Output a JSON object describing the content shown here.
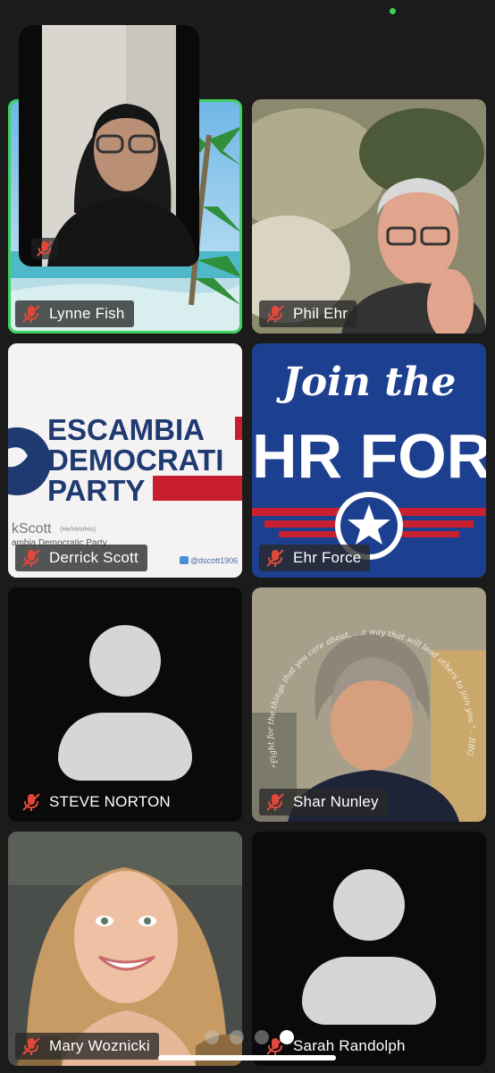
{
  "self_view": {
    "muted": true
  },
  "participants": [
    {
      "name": "Lynne Fish",
      "muted": true,
      "active_speaker": true,
      "video": "beach-background"
    },
    {
      "name": "Phil Ehr",
      "muted": true,
      "video": "camera"
    },
    {
      "name": "Derrick Scott",
      "muted": true,
      "video": "logo",
      "logo": {
        "line1": "ESCAMBIA",
        "line2": "DEMOCRATI",
        "line3": "PARTY",
        "caption_name": "kScott",
        "caption_suffix": "(He/Him/His)",
        "caption_org": "ambia Democratic Party",
        "handle": "@dscott1906"
      }
    },
    {
      "name": "Ehr Force",
      "muted": true,
      "video": "logo",
      "logo": {
        "line1": "Join the",
        "line2": "HR FORC"
      }
    },
    {
      "name": "STEVE NORTON",
      "muted": true,
      "video": "off"
    },
    {
      "name": "Shar Nunley",
      "muted": true,
      "video": "camera",
      "ring_text": "\"Fight for the things that you care about, ...a way that will lead others to join you.\" - RBG"
    },
    {
      "name": "Mary Woznicki",
      "muted": true,
      "video": "camera"
    },
    {
      "name": "Sarah Randolph",
      "muted": true,
      "video": "off"
    }
  ],
  "pager": {
    "pages": 4,
    "current": 4
  },
  "colors": {
    "background": "#1b1b1b",
    "active_speaker_border": "#3fd05e",
    "muted_icon": "#e0483c"
  }
}
